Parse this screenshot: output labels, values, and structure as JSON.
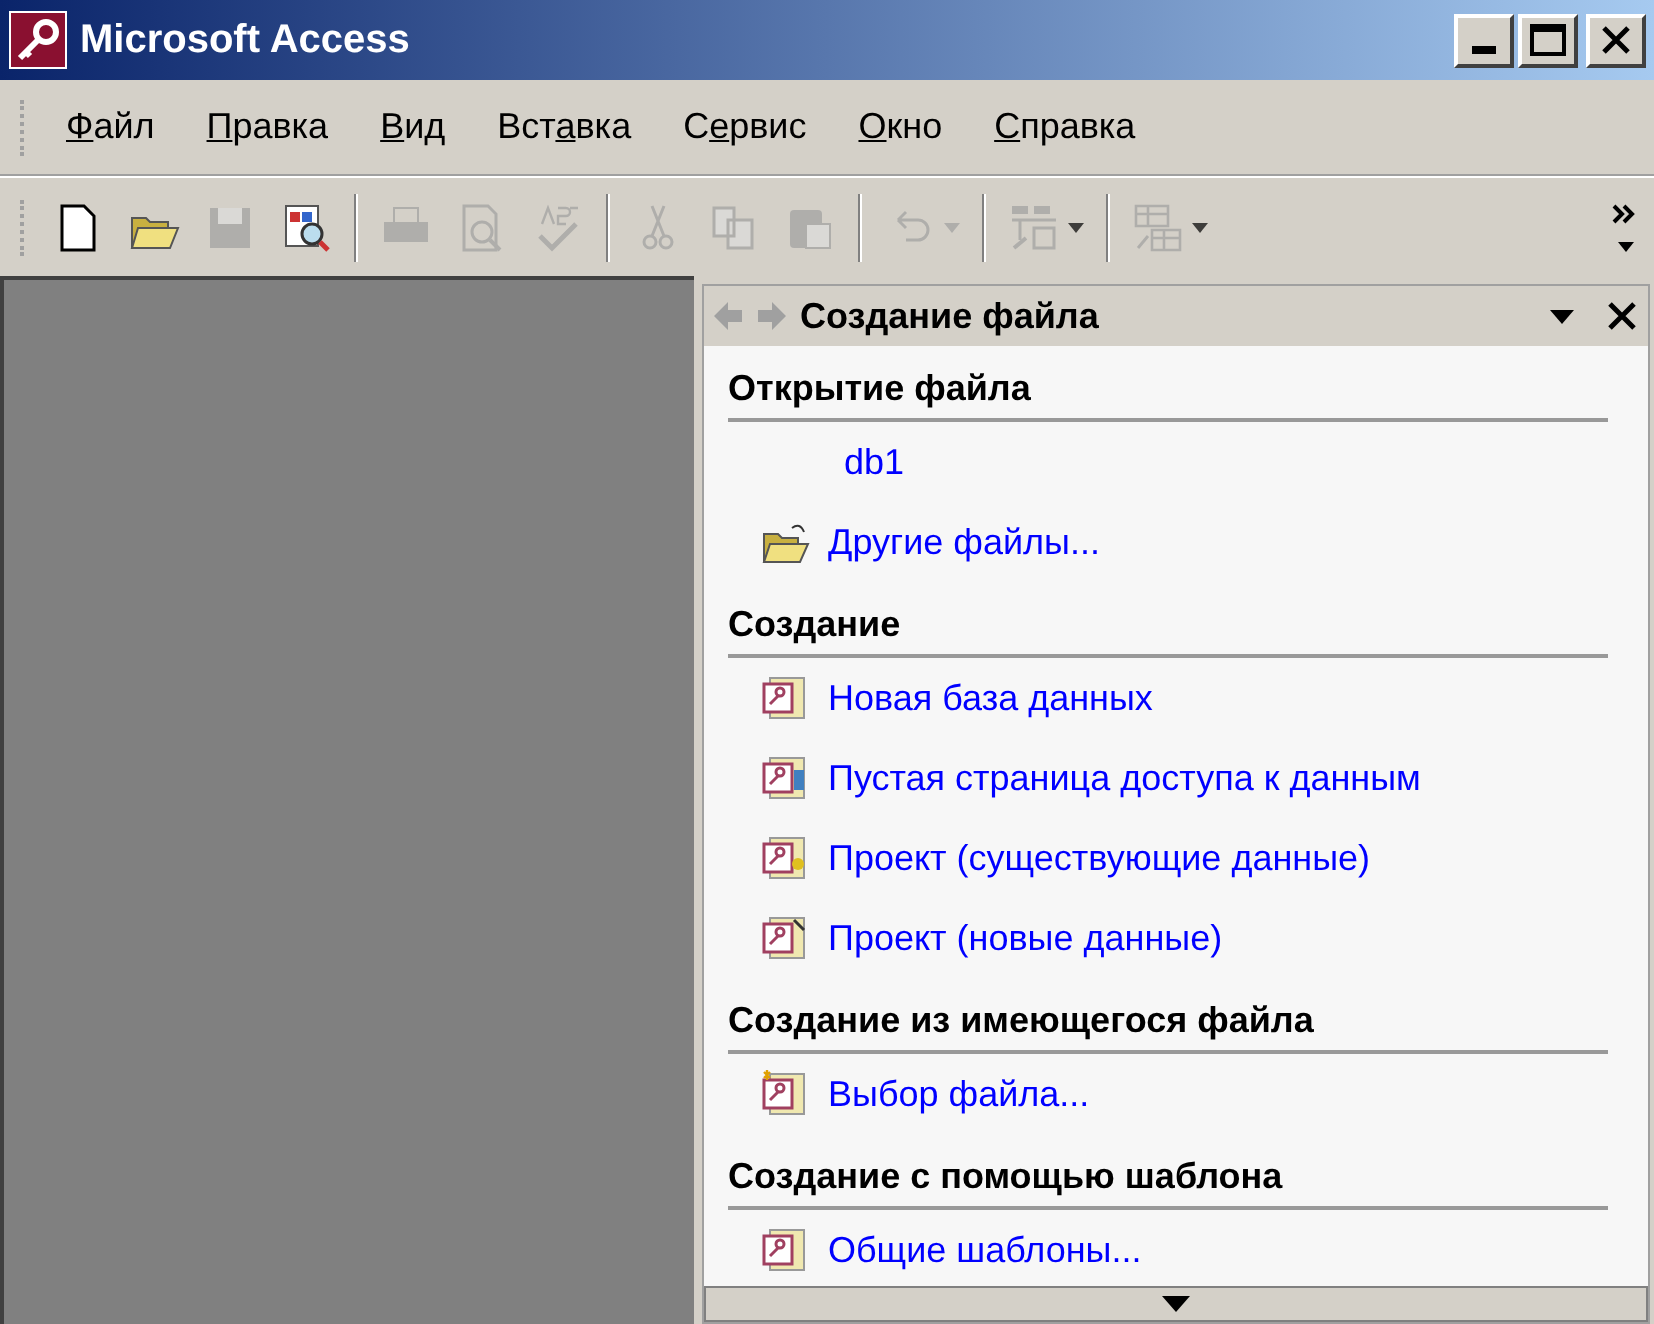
{
  "window": {
    "title": "Microsoft Access"
  },
  "menu": [
    {
      "key": "Ф",
      "after": "айл"
    },
    {
      "key": "П",
      "after": "равка"
    },
    {
      "key": "В",
      "after": "ид"
    },
    {
      "before": "Вст",
      "key": "а",
      "after": "вка"
    },
    {
      "before": "С",
      "key": "е",
      "after": "рвис"
    },
    {
      "key": "О",
      "after": "кно"
    },
    {
      "key": "С",
      "after": "правка"
    }
  ],
  "toolbar": [
    {
      "kind": "new",
      "disabled": false
    },
    {
      "kind": "open",
      "disabled": false
    },
    {
      "kind": "save",
      "disabled": true
    },
    {
      "kind": "search",
      "disabled": false
    },
    {
      "kind": "sep"
    },
    {
      "kind": "print",
      "disabled": true
    },
    {
      "kind": "preview",
      "disabled": true
    },
    {
      "kind": "spell",
      "disabled": true
    },
    {
      "kind": "sep"
    },
    {
      "kind": "cut",
      "disabled": true
    },
    {
      "kind": "copy",
      "disabled": true
    },
    {
      "kind": "paste",
      "disabled": true
    },
    {
      "kind": "sep"
    },
    {
      "kind": "undo",
      "disabled": true
    },
    {
      "kind": "sep"
    },
    {
      "kind": "links",
      "disabled": true
    },
    {
      "kind": "sep"
    },
    {
      "kind": "analyze",
      "disabled": true
    }
  ],
  "task_pane": {
    "title": "Создание файла",
    "sections": [
      {
        "heading": "Открытие файла",
        "items": [
          {
            "kind": "recent",
            "label": "db1"
          },
          {
            "kind": "folder",
            "label": "Другие файлы..."
          }
        ]
      },
      {
        "heading": "Создание",
        "items": [
          {
            "kind": "database",
            "label": "Новая база данных"
          },
          {
            "kind": "page",
            "label": "Пустая страница доступа к данным"
          },
          {
            "kind": "project-existing",
            "label": "Проект (существующие данные)"
          },
          {
            "kind": "project-new",
            "label": "Проект (новые данные)"
          }
        ]
      },
      {
        "heading": "Создание из имеющегося файла",
        "items": [
          {
            "kind": "choose",
            "label": "Выбор файла..."
          }
        ]
      },
      {
        "heading": "Создание с помощью шаблона",
        "items": [
          {
            "kind": "database",
            "label": "Общие шаблоны..."
          }
        ]
      }
    ]
  }
}
